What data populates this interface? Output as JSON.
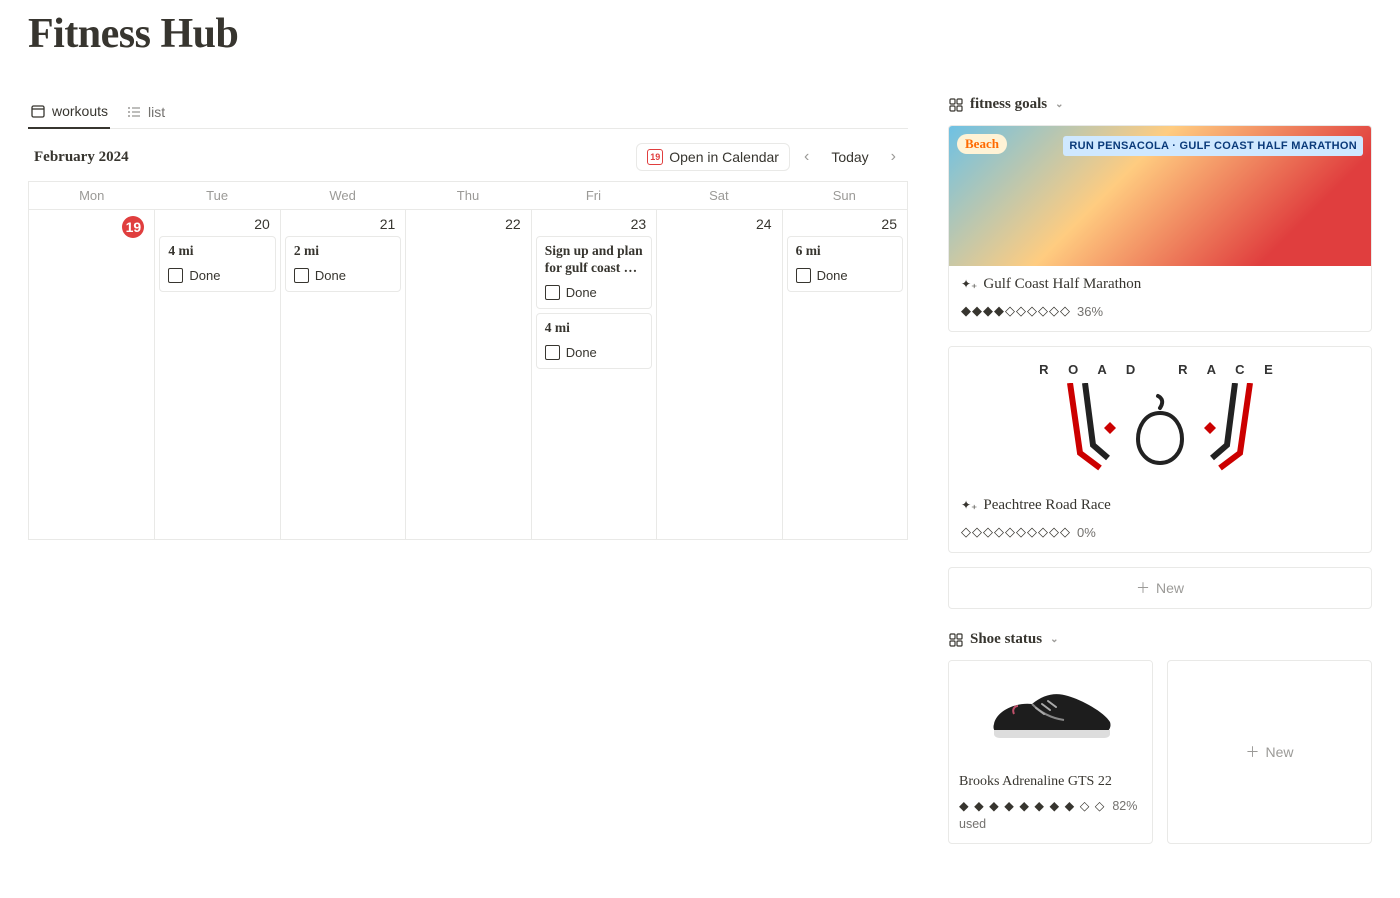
{
  "page_title": "Fitness Hub",
  "tabs": {
    "workouts": "workouts",
    "list": "list"
  },
  "calendar": {
    "month_label": "February 2024",
    "open_btn": "Open in Calendar",
    "open_btn_day": "19",
    "today_btn": "Today",
    "dow": [
      "Mon",
      "Tue",
      "Wed",
      "Thu",
      "Fri",
      "Sat",
      "Sun"
    ],
    "days": {
      "mon": "19",
      "tue": "20",
      "wed": "21",
      "thu": "22",
      "fri": "23",
      "sat": "24",
      "sun": "25"
    },
    "events": {
      "tue": [
        {
          "title": "4 mi",
          "done_label": "Done"
        }
      ],
      "wed": [
        {
          "title": "2 mi",
          "done_label": "Done"
        }
      ],
      "fri": [
        {
          "title": "Sign up and plan for gulf coast …",
          "done_label": "Done"
        },
        {
          "title": "4 mi",
          "done_label": "Done"
        }
      ],
      "sun": [
        {
          "title": "6 mi",
          "done_label": "Done"
        }
      ]
    }
  },
  "goals_header": "fitness goals",
  "goals": [
    {
      "title": "Gulf Coast Half Marathon",
      "progress_diamonds": "◆◆◆◆◇◇◇◇◇◇",
      "progress_pct": "36%"
    },
    {
      "title": "Peachtree Road Race",
      "progress_diamonds": "◇◇◇◇◇◇◇◇◇◇",
      "progress_pct": "0%"
    }
  ],
  "new_label": "New",
  "shoe_header": "Shoe status",
  "shoes": [
    {
      "title": "Brooks Adrenaline GTS 22",
      "progress_diamonds": "◆ ◆ ◆ ◆ ◆ ◆ ◆ ◆ ◇ ◇",
      "progress_label": "82% used"
    }
  ]
}
